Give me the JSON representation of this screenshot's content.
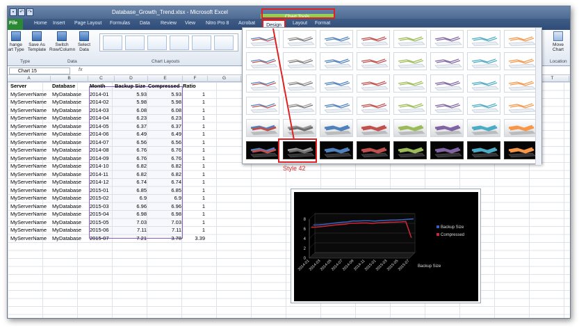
{
  "window": {
    "title": "Database_Growth_Trend.xlsx - Microsoft Excel"
  },
  "tabs": [
    "File",
    "Home",
    "Insert",
    "Page Layout",
    "Formulas",
    "Data",
    "Review",
    "View",
    "Nitro Pro 8",
    "Acrobat",
    "Design",
    "Layout",
    "Format"
  ],
  "chart_tools": "Chart Tools",
  "ribbon": {
    "change_type": [
      "hange",
      "art Type"
    ],
    "save_template": [
      "Save As",
      "Template"
    ],
    "group_type": "Type",
    "switch": [
      "Switch",
      "Row/Column"
    ],
    "select_data": [
      "Select",
      "Data"
    ],
    "group_data": "Data",
    "group_layouts": "Chart Layouts",
    "move_chart": [
      "Move",
      "Chart"
    ],
    "group_location": "Location"
  },
  "namebox": "Chart 15",
  "fx": "fx",
  "columns": [
    "A",
    "B",
    "C",
    "D",
    "E",
    "F",
    "G",
    "T"
  ],
  "headers": [
    "Server",
    "Database",
    "Month",
    "Backup Size",
    "Compressed",
    "Ratio"
  ],
  "rows": [
    [
      "MyServerName",
      "MyDatabase",
      "2014-01",
      "5.93",
      "5.93",
      "1"
    ],
    [
      "MyServerName",
      "MyDatabase",
      "2014-02",
      "5.98",
      "5.98",
      "1"
    ],
    [
      "MyServerName",
      "MyDatabase",
      "2014-03",
      "6.08",
      "6.08",
      "1"
    ],
    [
      "MyServerName",
      "MyDatabase",
      "2014-04",
      "6.23",
      "6.23",
      "1"
    ],
    [
      "MyServerName",
      "MyDatabase",
      "2014-05",
      "6.37",
      "6.37",
      "1"
    ],
    [
      "MyServerName",
      "MyDatabase",
      "2014-06",
      "6.49",
      "6.49",
      "1"
    ],
    [
      "MyServerName",
      "MyDatabase",
      "2014-07",
      "6.56",
      "6.56",
      "1"
    ],
    [
      "MyServerName",
      "MyDatabase",
      "2014-08",
      "6.76",
      "6.76",
      "1"
    ],
    [
      "MyServerName",
      "MyDatabase",
      "2014-09",
      "6.76",
      "6.76",
      "1"
    ],
    [
      "MyServerName",
      "MyDatabase",
      "2014-10",
      "6.82",
      "6.82",
      "1"
    ],
    [
      "MyServerName",
      "MyDatabase",
      "2014-11",
      "6.82",
      "6.82",
      "1"
    ],
    [
      "MyServerName",
      "MyDatabase",
      "2014-12",
      "6.74",
      "6.74",
      "1"
    ],
    [
      "MyServerName",
      "MyDatabase",
      "2015-01",
      "6.85",
      "6.85",
      "1"
    ],
    [
      "MyServerName",
      "MyDatabase",
      "2015-02",
      "6.9",
      "6.9",
      "1"
    ],
    [
      "MyServerName",
      "MyDatabase",
      "2015-03",
      "6.96",
      "6.96",
      "1"
    ],
    [
      "MyServerName",
      "MyDatabase",
      "2015-04",
      "6.98",
      "6.98",
      "1"
    ],
    [
      "MyServerName",
      "MyDatabase",
      "2015-05",
      "7.03",
      "7.03",
      "1"
    ],
    [
      "MyServerName",
      "MyDatabase",
      "2015-06",
      "7.11",
      "7.11",
      "1"
    ],
    [
      "MyServerName",
      "MyDatabase",
      "2015-07",
      "7.21",
      "3.78",
      "3.39"
    ]
  ],
  "style_label": "Style 42",
  "chart_data": {
    "type": "line",
    "title": "",
    "xlabel": "",
    "ylabel": "",
    "ylim": [
      0,
      8
    ],
    "yticks": [
      "0",
      "2",
      "4",
      "6",
      "8"
    ],
    "xticks": [
      "2014-01",
      "2014-03",
      "2014-05",
      "2014-07",
      "2014-09",
      "2014-11",
      "2015-01",
      "2015-03",
      "2015-05",
      "2015-07"
    ],
    "depth_axis_label": "Backup Size",
    "series": [
      {
        "name": "Backup Size",
        "color": "#3a5fb0",
        "values": [
          5.93,
          5.98,
          6.08,
          6.23,
          6.37,
          6.49,
          6.56,
          6.76,
          6.76,
          6.82,
          6.82,
          6.74,
          6.85,
          6.9,
          6.96,
          6.98,
          7.03,
          7.11,
          7.21
        ]
      },
      {
        "name": "Compressed",
        "color": "#c8283a",
        "values": [
          5.93,
          5.98,
          6.08,
          6.23,
          6.37,
          6.49,
          6.56,
          6.76,
          6.76,
          6.82,
          6.82,
          6.74,
          6.85,
          6.9,
          6.96,
          6.98,
          7.03,
          7.11,
          3.78
        ]
      }
    ],
    "legend": "right",
    "background": "#000000"
  }
}
